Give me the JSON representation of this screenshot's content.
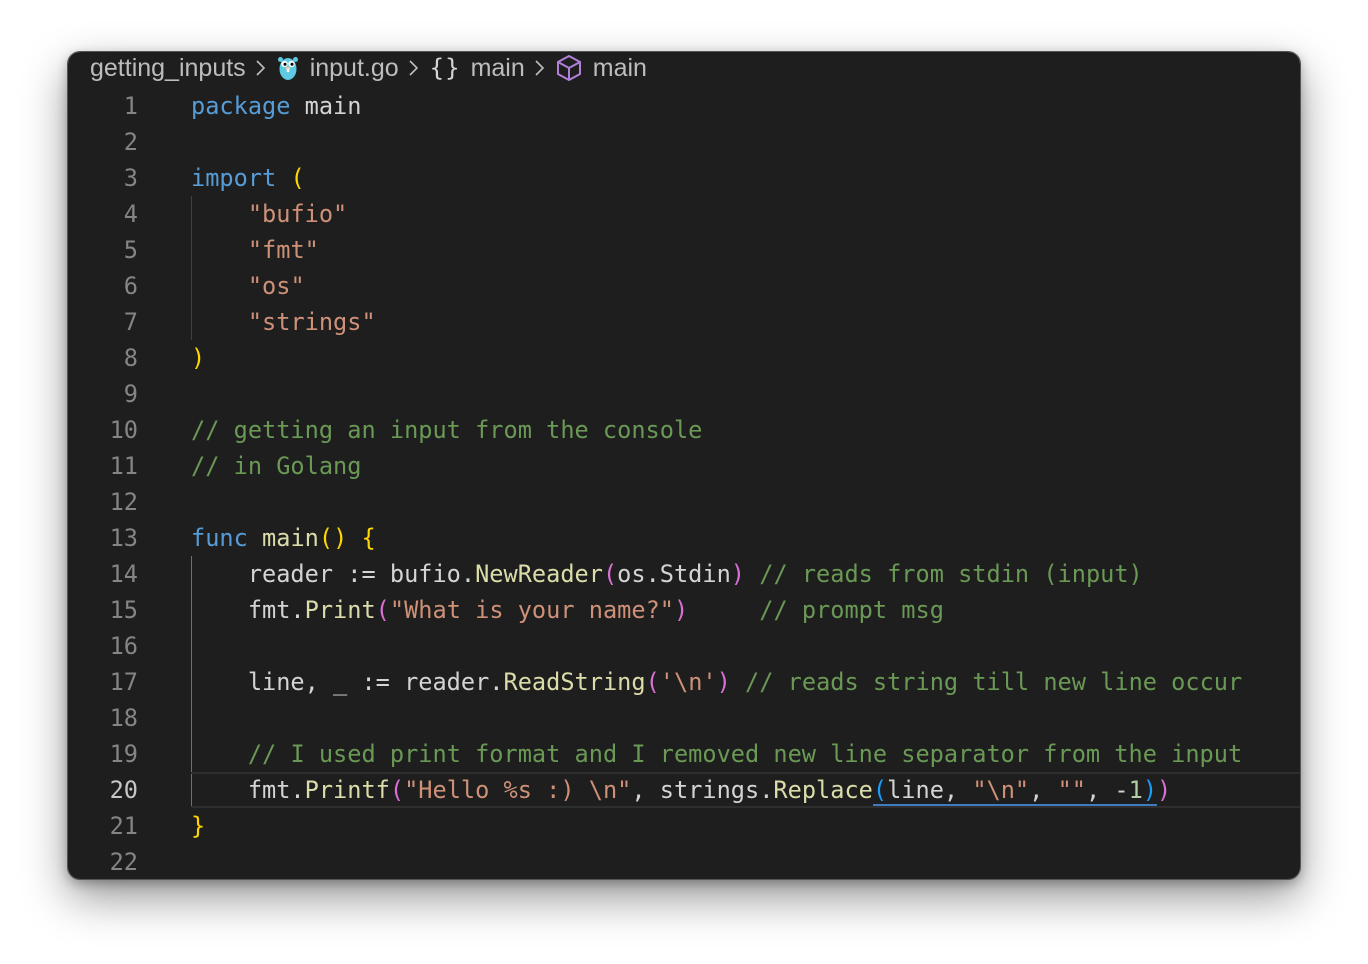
{
  "breadcrumb": {
    "folder": "getting_inputs",
    "file": "input.go",
    "scope": "main",
    "symbol": "main",
    "icons": {
      "file": "gopher-icon",
      "scope": "braces-icon",
      "symbol": "cube-icon",
      "separator": "chevron-right-icon"
    }
  },
  "editor": {
    "active_line": 20,
    "lines": [
      {
        "n": "1",
        "tokens": [
          [
            "kw",
            "package"
          ],
          [
            "pk",
            " main"
          ]
        ]
      },
      {
        "n": "2",
        "tokens": []
      },
      {
        "n": "3",
        "tokens": [
          [
            "kw",
            "import"
          ],
          [
            "pk",
            " "
          ],
          [
            "b1",
            "("
          ]
        ]
      },
      {
        "n": "4",
        "tokens": [
          [
            "pk",
            "    "
          ],
          [
            "str",
            "\"bufio\""
          ]
        ]
      },
      {
        "n": "5",
        "tokens": [
          [
            "pk",
            "    "
          ],
          [
            "str",
            "\"fmt\""
          ]
        ]
      },
      {
        "n": "6",
        "tokens": [
          [
            "pk",
            "    "
          ],
          [
            "str",
            "\"os\""
          ]
        ]
      },
      {
        "n": "7",
        "tokens": [
          [
            "pk",
            "    "
          ],
          [
            "str",
            "\"strings\""
          ]
        ]
      },
      {
        "n": "8",
        "tokens": [
          [
            "b1",
            ")"
          ]
        ]
      },
      {
        "n": "9",
        "tokens": []
      },
      {
        "n": "10",
        "tokens": [
          [
            "com",
            "// getting an input from the console"
          ]
        ]
      },
      {
        "n": "11",
        "tokens": [
          [
            "com",
            "// in Golang"
          ]
        ]
      },
      {
        "n": "12",
        "tokens": []
      },
      {
        "n": "13",
        "tokens": [
          [
            "kw",
            "func"
          ],
          [
            "pk",
            " "
          ],
          [
            "fn",
            "main"
          ],
          [
            "b1",
            "()"
          ],
          [
            "pk",
            " "
          ],
          [
            "b1",
            "{"
          ]
        ]
      },
      {
        "n": "14",
        "tokens": [
          [
            "pk",
            "    reader := bufio."
          ],
          [
            "fn",
            "NewReader"
          ],
          [
            "b2",
            "("
          ],
          [
            "pk",
            "os.Stdin"
          ],
          [
            "b2",
            ")"
          ],
          [
            "pk",
            " "
          ],
          [
            "com",
            "// reads from stdin (input)"
          ]
        ]
      },
      {
        "n": "15",
        "tokens": [
          [
            "pk",
            "    fmt."
          ],
          [
            "fn",
            "Print"
          ],
          [
            "b2",
            "("
          ],
          [
            "str",
            "\"What is your name?\""
          ],
          [
            "b2",
            ")"
          ],
          [
            "pk",
            "     "
          ],
          [
            "com",
            "// prompt msg"
          ]
        ]
      },
      {
        "n": "16",
        "tokens": []
      },
      {
        "n": "17",
        "tokens": [
          [
            "pk",
            "    line, _ := reader."
          ],
          [
            "fn",
            "ReadString"
          ],
          [
            "b2",
            "("
          ],
          [
            "str",
            "'\\n'"
          ],
          [
            "b2",
            ")"
          ],
          [
            "pk",
            " "
          ],
          [
            "com",
            "// reads string till new line occur"
          ]
        ]
      },
      {
        "n": "18",
        "tokens": []
      },
      {
        "n": "19",
        "tokens": [
          [
            "pk",
            "    "
          ],
          [
            "com",
            "// I used print format and I removed new line separator from the input"
          ]
        ]
      },
      {
        "n": "20",
        "tokens": [
          [
            "pk",
            "    fmt."
          ],
          [
            "fn",
            "Printf"
          ],
          [
            "b2",
            "("
          ],
          [
            "str",
            "\"Hello %s :) \\n\""
          ],
          [
            "pk",
            ", strings."
          ],
          [
            "fn",
            "Replace"
          ],
          [
            "b3u",
            "("
          ],
          [
            "pku",
            "line, "
          ],
          [
            "stru",
            "\"\\n\""
          ],
          [
            "pku",
            ", "
          ],
          [
            "stru",
            "\"\""
          ],
          [
            "pku",
            ", -"
          ],
          [
            "numu",
            "1"
          ],
          [
            "b3u",
            ")"
          ],
          [
            "b2",
            ")"
          ]
        ]
      },
      {
        "n": "21",
        "tokens": [
          [
            "b1",
            "}"
          ]
        ]
      },
      {
        "n": "22",
        "tokens": []
      }
    ]
  },
  "colors": {
    "background": "#1e1e1e",
    "keyword": "#569cd6",
    "function": "#dcdcaa",
    "string": "#ce9178",
    "comment": "#6a9955",
    "number": "#b5cea8",
    "bracket_level_1": "#ffd700",
    "bracket_level_2": "#da70d6",
    "bracket_level_3": "#179fff"
  }
}
